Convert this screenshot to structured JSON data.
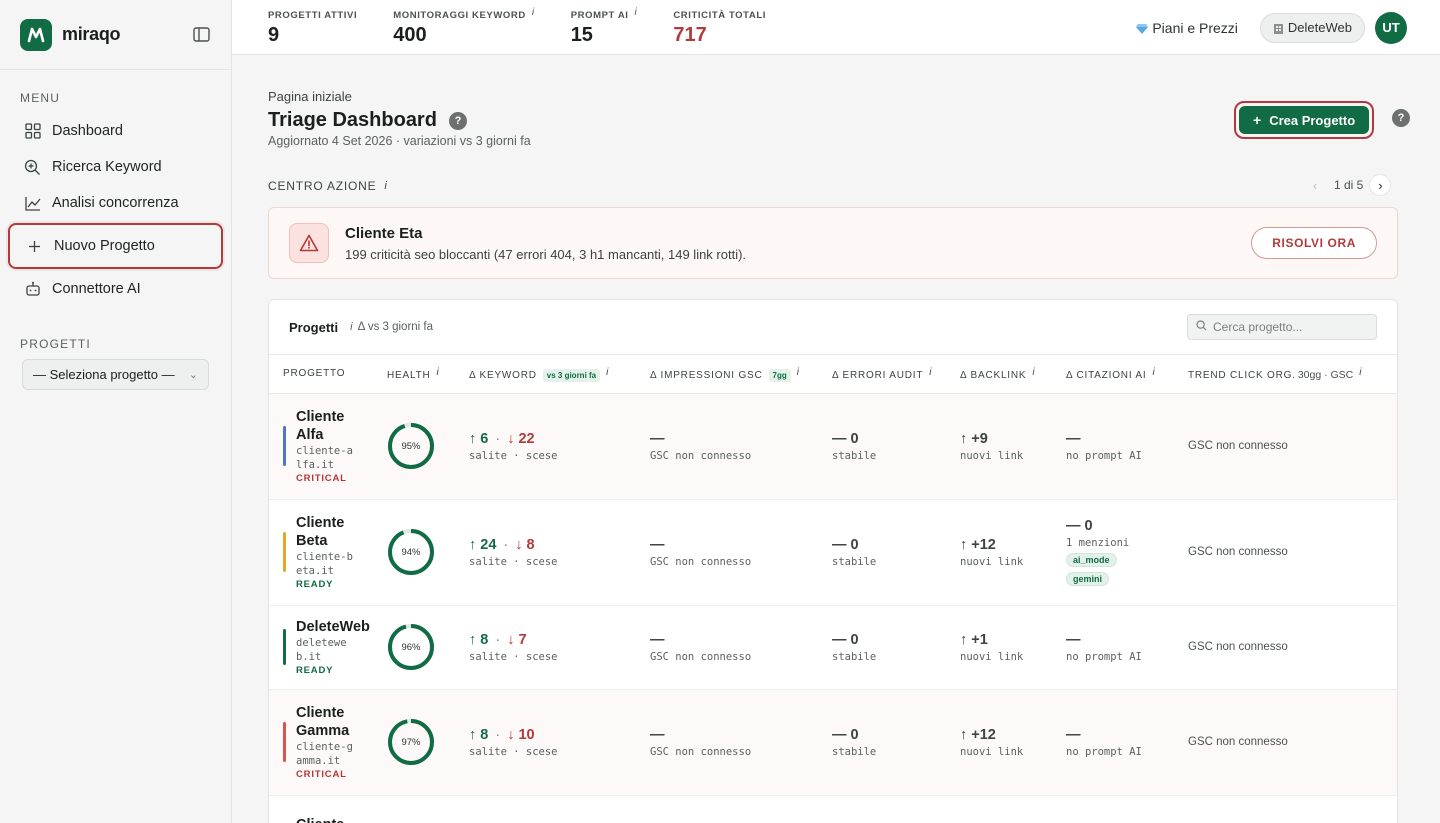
{
  "brand": {
    "name": "miraqo",
    "accent": "#116b45",
    "critical": "#b23a3a"
  },
  "sidebar": {
    "menu_title": "MENU",
    "items": [
      {
        "label": "Dashboard",
        "icon": "grid-icon"
      },
      {
        "label": "Ricerca Keyword",
        "icon": "search-plus-icon"
      },
      {
        "label": "Analisi concorrenza",
        "icon": "chart-line-icon"
      },
      {
        "label": "Nuovo Progetto",
        "icon": "plus-icon"
      },
      {
        "label": "Connettore AI",
        "icon": "robot-icon"
      }
    ],
    "projects_title": "PROGETTI",
    "project_select": "— Seleziona progetto —"
  },
  "topbar": {
    "stats": [
      {
        "label": "PROGETTI ATTIVI",
        "value": "9",
        "info": ""
      },
      {
        "label": "MONITORAGGI KEYWORD",
        "value": "400",
        "info": "i"
      },
      {
        "label": "PROMPT AI",
        "value": "15",
        "info": "i"
      },
      {
        "label": "CRITICITÀ TOTALI",
        "value": "717",
        "info": ""
      }
    ],
    "plans": "Piani e Prezzi",
    "workspace": "DeleteWeb",
    "avatar": "UT"
  },
  "page": {
    "breadcrumb": "Pagina iniziale",
    "title": "Triage Dashboard",
    "updated": "Aggiornato 4 Set 2026 · variazioni vs 3 giorni fa",
    "cta": "Crea Progetto",
    "help": "?"
  },
  "action_center": {
    "label": "CENTRO AZIONE",
    "info": "i",
    "pager": "1 di 5",
    "alert_title": "Cliente Eta",
    "alert_desc": "199 criticità seo bloccanti (47 errori 404, 3 h1 mancanti, 149 link rotti).",
    "resolve": "RISOLVI ORA"
  },
  "projects_card": {
    "title": "Progetti",
    "info": "i",
    "subtitle": "Δ vs 3 giorni fa",
    "search_placeholder": "Cerca progetto...",
    "columns": {
      "project": "PROGETTO",
      "health": "HEALTH",
      "keyword": "Δ KEYWORD",
      "keyword_tag": "vs 3 giorni fa",
      "impressions": "Δ IMPRESSIONI GSC",
      "impressions_tag": "7gg",
      "audit": "Δ ERRORI AUDIT",
      "backlink": "Δ BACKLINK",
      "citations": "Δ CITAZIONI AI",
      "trend": "TREND CLICK ORG.",
      "trend_extra": "30gg · GSC",
      "info": "i"
    },
    "rows": [
      {
        "name": "Cliente Alfa",
        "domain": "cliente-alfa.it",
        "status": "CRITICAL",
        "health": 95,
        "health_label": "95%",
        "bar_color": "#4a78c2",
        "kw_up": "↑ 6",
        "kw_down": "↓ 22",
        "kw_sub": "salite · scese",
        "gsc": "—",
        "gsc_sub": "GSC non connesso",
        "audit": "— 0",
        "audit_sub": "stabile",
        "backlink": "↑ +9",
        "backlink_sub": "nuovi link",
        "citations": "—",
        "citations_sub": "no prompt AI",
        "pills": [],
        "trend": "GSC non connesso"
      },
      {
        "name": "Cliente Beta",
        "domain": "cliente-beta.it",
        "status": "READY",
        "health": 94,
        "health_label": "94%",
        "bar_color": "#e3a72f",
        "kw_up": "↑ 24",
        "kw_down": "↓ 8",
        "kw_sub": "salite · scese",
        "gsc": "—",
        "gsc_sub": "GSC non connesso",
        "audit": "— 0",
        "audit_sub": "stabile",
        "backlink": "↑ +12",
        "backlink_sub": "nuovi link",
        "citations": "— 0",
        "citations_sub": "1 menzioni",
        "pills": [
          "ai_mode",
          "gemini"
        ],
        "trend": "GSC non connesso"
      },
      {
        "name": "DeleteWeb",
        "domain": "deleteweb.it",
        "status": "READY",
        "health": 96,
        "health_label": "96%",
        "bar_color": "#116b45",
        "kw_up": "↑ 8",
        "kw_down": "↓ 7",
        "kw_sub": "salite · scese",
        "gsc": "—",
        "gsc_sub": "GSC non connesso",
        "audit": "— 0",
        "audit_sub": "stabile",
        "backlink": "↑ +1",
        "backlink_sub": "nuovi link",
        "citations": "—",
        "citations_sub": "no prompt AI",
        "pills": [],
        "trend": "GSC non connesso"
      },
      {
        "name": "Cliente Gamma",
        "domain": "cliente-gamma.it",
        "status": "CRITICAL",
        "health": 97,
        "health_label": "97%",
        "bar_color": "#d9534f",
        "kw_up": "↑ 8",
        "kw_down": "↓ 10",
        "kw_sub": "salite · scese",
        "gsc": "—",
        "gsc_sub": "GSC non connesso",
        "audit": "— 0",
        "audit_sub": "stabile",
        "backlink": "↑ +12",
        "backlink_sub": "nuovi link",
        "citations": "—",
        "citations_sub": "no prompt AI",
        "pills": [],
        "trend": "GSC non connesso"
      },
      {
        "name": "Cliente",
        "domain": "",
        "status": "",
        "health": null,
        "health_label": "",
        "bar_color": "#4a78c2",
        "kw_up": "",
        "kw_down": "",
        "kw_sub": "",
        "gsc": "",
        "gsc_sub": "",
        "audit": "",
        "audit_sub": "",
        "backlink": "",
        "backlink_sub": "",
        "citations": "",
        "citations_sub": "",
        "pills": [],
        "trend": ""
      }
    ]
  }
}
